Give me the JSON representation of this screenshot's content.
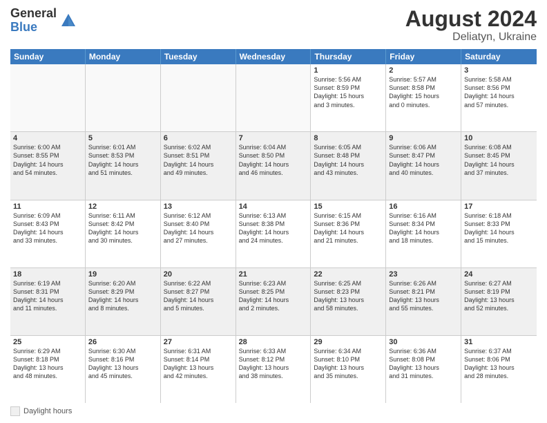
{
  "logo": {
    "general": "General",
    "blue": "Blue"
  },
  "title": {
    "month_year": "August 2024",
    "location": "Deliatyn, Ukraine"
  },
  "header_days": [
    "Sunday",
    "Monday",
    "Tuesday",
    "Wednesday",
    "Thursday",
    "Friday",
    "Saturday"
  ],
  "weeks": [
    [
      {
        "day": "",
        "info": ""
      },
      {
        "day": "",
        "info": ""
      },
      {
        "day": "",
        "info": ""
      },
      {
        "day": "",
        "info": ""
      },
      {
        "day": "1",
        "info": "Sunrise: 5:56 AM\nSunset: 8:59 PM\nDaylight: 15 hours\nand 3 minutes."
      },
      {
        "day": "2",
        "info": "Sunrise: 5:57 AM\nSunset: 8:58 PM\nDaylight: 15 hours\nand 0 minutes."
      },
      {
        "day": "3",
        "info": "Sunrise: 5:58 AM\nSunset: 8:56 PM\nDaylight: 14 hours\nand 57 minutes."
      }
    ],
    [
      {
        "day": "4",
        "info": "Sunrise: 6:00 AM\nSunset: 8:55 PM\nDaylight: 14 hours\nand 54 minutes."
      },
      {
        "day": "5",
        "info": "Sunrise: 6:01 AM\nSunset: 8:53 PM\nDaylight: 14 hours\nand 51 minutes."
      },
      {
        "day": "6",
        "info": "Sunrise: 6:02 AM\nSunset: 8:51 PM\nDaylight: 14 hours\nand 49 minutes."
      },
      {
        "day": "7",
        "info": "Sunrise: 6:04 AM\nSunset: 8:50 PM\nDaylight: 14 hours\nand 46 minutes."
      },
      {
        "day": "8",
        "info": "Sunrise: 6:05 AM\nSunset: 8:48 PM\nDaylight: 14 hours\nand 43 minutes."
      },
      {
        "day": "9",
        "info": "Sunrise: 6:06 AM\nSunset: 8:47 PM\nDaylight: 14 hours\nand 40 minutes."
      },
      {
        "day": "10",
        "info": "Sunrise: 6:08 AM\nSunset: 8:45 PM\nDaylight: 14 hours\nand 37 minutes."
      }
    ],
    [
      {
        "day": "11",
        "info": "Sunrise: 6:09 AM\nSunset: 8:43 PM\nDaylight: 14 hours\nand 33 minutes."
      },
      {
        "day": "12",
        "info": "Sunrise: 6:11 AM\nSunset: 8:42 PM\nDaylight: 14 hours\nand 30 minutes."
      },
      {
        "day": "13",
        "info": "Sunrise: 6:12 AM\nSunset: 8:40 PM\nDaylight: 14 hours\nand 27 minutes."
      },
      {
        "day": "14",
        "info": "Sunrise: 6:13 AM\nSunset: 8:38 PM\nDaylight: 14 hours\nand 24 minutes."
      },
      {
        "day": "15",
        "info": "Sunrise: 6:15 AM\nSunset: 8:36 PM\nDaylight: 14 hours\nand 21 minutes."
      },
      {
        "day": "16",
        "info": "Sunrise: 6:16 AM\nSunset: 8:34 PM\nDaylight: 14 hours\nand 18 minutes."
      },
      {
        "day": "17",
        "info": "Sunrise: 6:18 AM\nSunset: 8:33 PM\nDaylight: 14 hours\nand 15 minutes."
      }
    ],
    [
      {
        "day": "18",
        "info": "Sunrise: 6:19 AM\nSunset: 8:31 PM\nDaylight: 14 hours\nand 11 minutes."
      },
      {
        "day": "19",
        "info": "Sunrise: 6:20 AM\nSunset: 8:29 PM\nDaylight: 14 hours\nand 8 minutes."
      },
      {
        "day": "20",
        "info": "Sunrise: 6:22 AM\nSunset: 8:27 PM\nDaylight: 14 hours\nand 5 minutes."
      },
      {
        "day": "21",
        "info": "Sunrise: 6:23 AM\nSunset: 8:25 PM\nDaylight: 14 hours\nand 2 minutes."
      },
      {
        "day": "22",
        "info": "Sunrise: 6:25 AM\nSunset: 8:23 PM\nDaylight: 13 hours\nand 58 minutes."
      },
      {
        "day": "23",
        "info": "Sunrise: 6:26 AM\nSunset: 8:21 PM\nDaylight: 13 hours\nand 55 minutes."
      },
      {
        "day": "24",
        "info": "Sunrise: 6:27 AM\nSunset: 8:19 PM\nDaylight: 13 hours\nand 52 minutes."
      }
    ],
    [
      {
        "day": "25",
        "info": "Sunrise: 6:29 AM\nSunset: 8:18 PM\nDaylight: 13 hours\nand 48 minutes."
      },
      {
        "day": "26",
        "info": "Sunrise: 6:30 AM\nSunset: 8:16 PM\nDaylight: 13 hours\nand 45 minutes."
      },
      {
        "day": "27",
        "info": "Sunrise: 6:31 AM\nSunset: 8:14 PM\nDaylight: 13 hours\nand 42 minutes."
      },
      {
        "day": "28",
        "info": "Sunrise: 6:33 AM\nSunset: 8:12 PM\nDaylight: 13 hours\nand 38 minutes."
      },
      {
        "day": "29",
        "info": "Sunrise: 6:34 AM\nSunset: 8:10 PM\nDaylight: 13 hours\nand 35 minutes."
      },
      {
        "day": "30",
        "info": "Sunrise: 6:36 AM\nSunset: 8:08 PM\nDaylight: 13 hours\nand 31 minutes."
      },
      {
        "day": "31",
        "info": "Sunrise: 6:37 AM\nSunset: 8:06 PM\nDaylight: 13 hours\nand 28 minutes."
      }
    ]
  ],
  "legend": {
    "box_label": "Daylight hours"
  }
}
